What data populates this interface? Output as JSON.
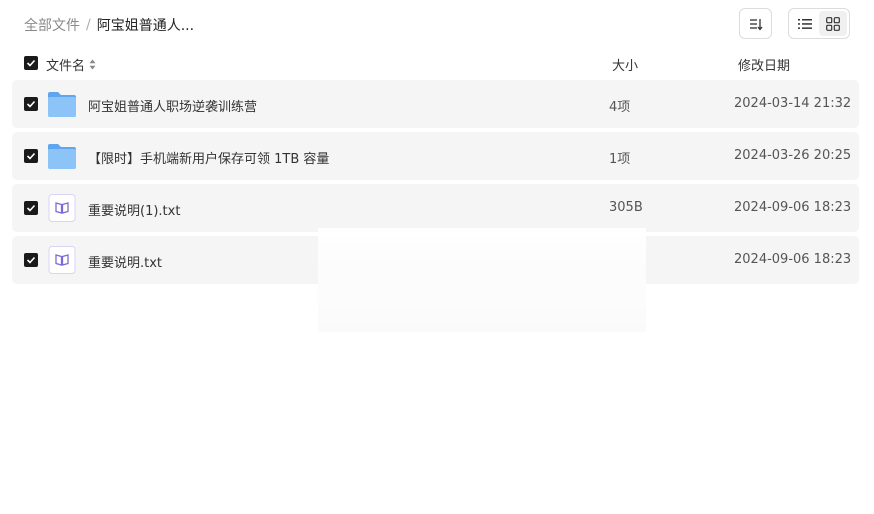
{
  "breadcrumb": {
    "root": "全部文件",
    "separator": "/",
    "current": "阿宝姐普通人..."
  },
  "toolbar": {
    "sort_icon": "sort-icon",
    "list_view_icon": "list-view-icon",
    "grid_view_icon": "grid-view-icon"
  },
  "table": {
    "headers": {
      "name": "文件名",
      "size": "大小",
      "date": "修改日期"
    },
    "rows": [
      {
        "type": "folder",
        "name": "阿宝姐普通人职场逆袭训练营",
        "size": "4项",
        "date": "2024-03-14 21:32"
      },
      {
        "type": "folder",
        "name": "【限时】手机端新用户保存可领 1TB 容量",
        "size": "1项",
        "date": "2024-03-26 20:25"
      },
      {
        "type": "txt",
        "name": "重要说明(1).txt",
        "size": "305B",
        "date": "2024-09-06 18:23"
      },
      {
        "type": "txt",
        "name": "重要说明.txt",
        "size": "",
        "date": "2024-09-06 18:23"
      }
    ]
  },
  "colors": {
    "folder": "#6ab0f3",
    "txt_icon": "#7b6bd6",
    "row_bg": "#f5f5f6"
  }
}
